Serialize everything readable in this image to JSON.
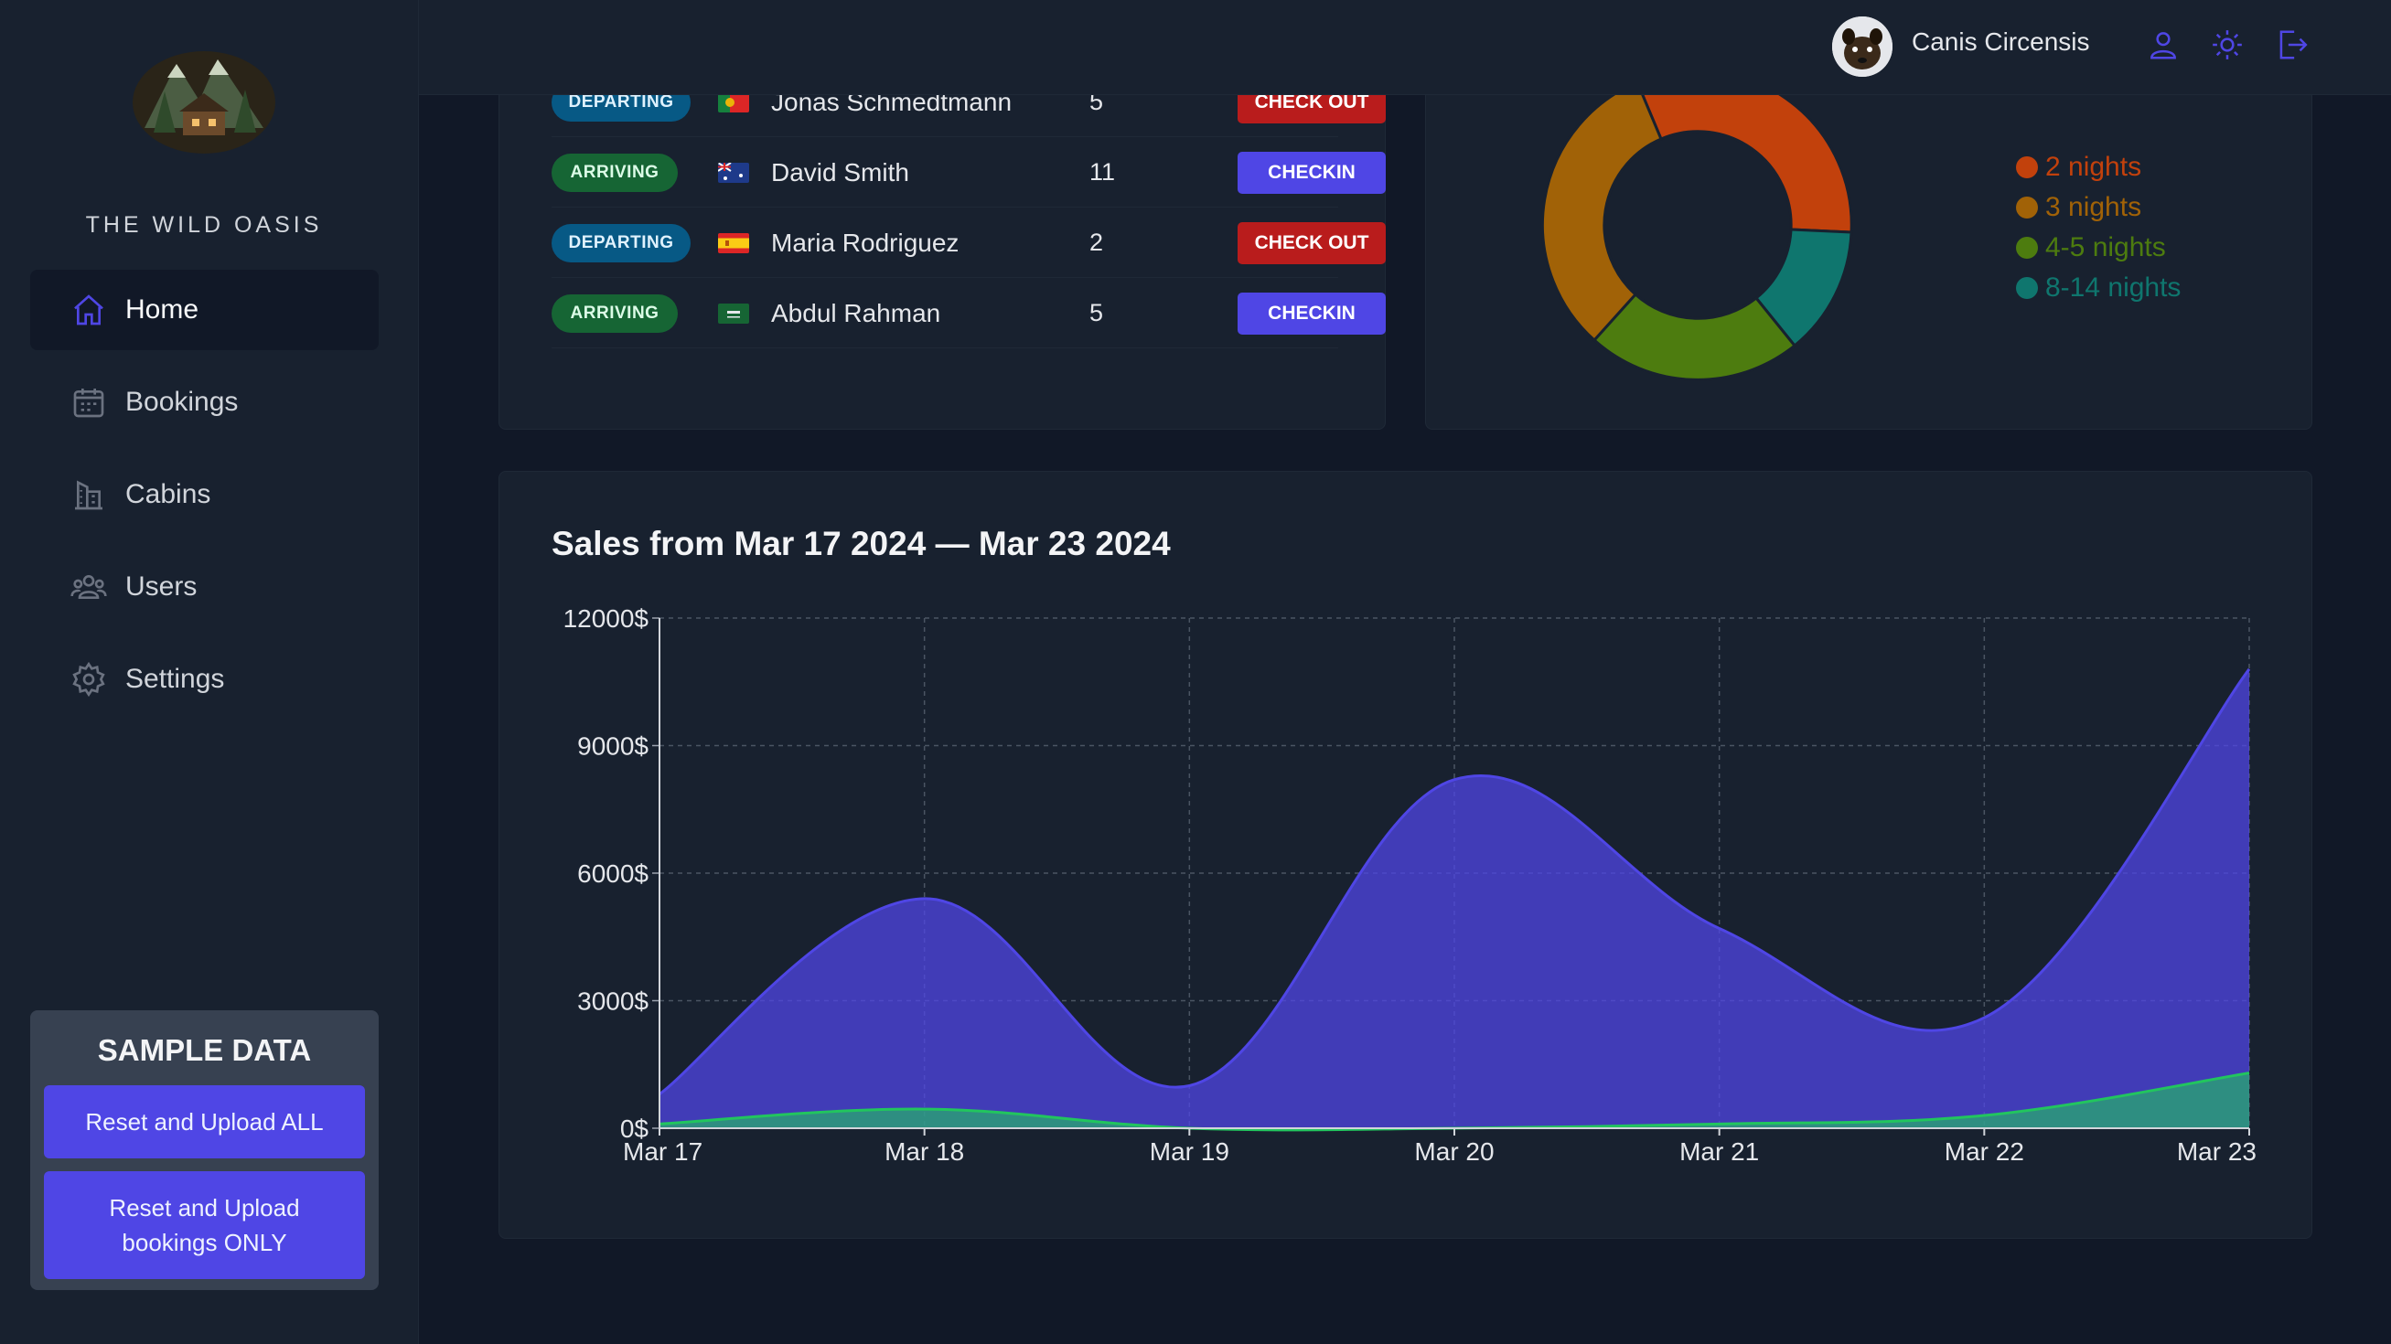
{
  "app": {
    "logo_text": "THE WILD OASIS"
  },
  "sidebar": {
    "items": [
      {
        "label": "Home",
        "icon": "home-icon",
        "active": true
      },
      {
        "label": "Bookings",
        "icon": "calendar-icon",
        "active": false
      },
      {
        "label": "Cabins",
        "icon": "building-icon",
        "active": false
      },
      {
        "label": "Users",
        "icon": "users-icon",
        "active": false
      },
      {
        "label": "Settings",
        "icon": "gear-icon",
        "active": false
      }
    ],
    "sample_data": {
      "title": "SAMPLE DATA",
      "reset_all_label": "Reset and Upload ALL",
      "reset_bookings_label": "Reset and Upload bookings ONLY"
    }
  },
  "header": {
    "user_name": "Canis Circensis",
    "icons": [
      "user-icon",
      "sun-icon",
      "logout-icon"
    ]
  },
  "today": {
    "rows": [
      {
        "status": "DEPARTING",
        "flag": "portugal",
        "guest": "Jonas Schmedtmann",
        "nights": "5",
        "action": "CHECK OUT"
      },
      {
        "status": "ARRIVING",
        "flag": "australia",
        "guest": "David Smith",
        "nights": "11",
        "action": "CHECKIN"
      },
      {
        "status": "DEPARTING",
        "flag": "spain",
        "guest": "Maria Rodriguez",
        "nights": "2",
        "action": "CHECK OUT"
      },
      {
        "status": "ARRIVING",
        "flag": "saudi-arabia",
        "guest": "Abdul Rahman",
        "nights": "5",
        "action": "CHECKIN"
      }
    ]
  },
  "durations": {
    "legend": [
      {
        "label": "2 nights",
        "color": "#c2410c"
      },
      {
        "label": "3 nights",
        "color": "#a16207"
      },
      {
        "label": "4-5 nights",
        "color": "#4d7c0f"
      },
      {
        "label": "8-14 nights",
        "color": "#0f766e"
      }
    ]
  },
  "sales": {
    "title": "Sales from Mar 17 2024 — Mar 23 2024"
  },
  "chart_data": {
    "type": "area",
    "x": [
      "Mar 17",
      "Mar 18",
      "Mar 19",
      "Mar 20",
      "Mar 21",
      "Mar 22",
      "Mar 23"
    ],
    "series": [
      {
        "values": [
          800,
          5400,
          1000,
          8200,
          4700,
          2600,
          10800
        ],
        "color": "#4f46e5"
      },
      {
        "values": [
          100,
          450,
          0,
          0,
          100,
          300,
          1300
        ],
        "color": "#22c55e"
      }
    ],
    "y_ticks": [
      "0$",
      "3000$",
      "6000$",
      "9000$",
      "12000$"
    ],
    "ylim": [
      0,
      12000
    ],
    "grid": true
  }
}
